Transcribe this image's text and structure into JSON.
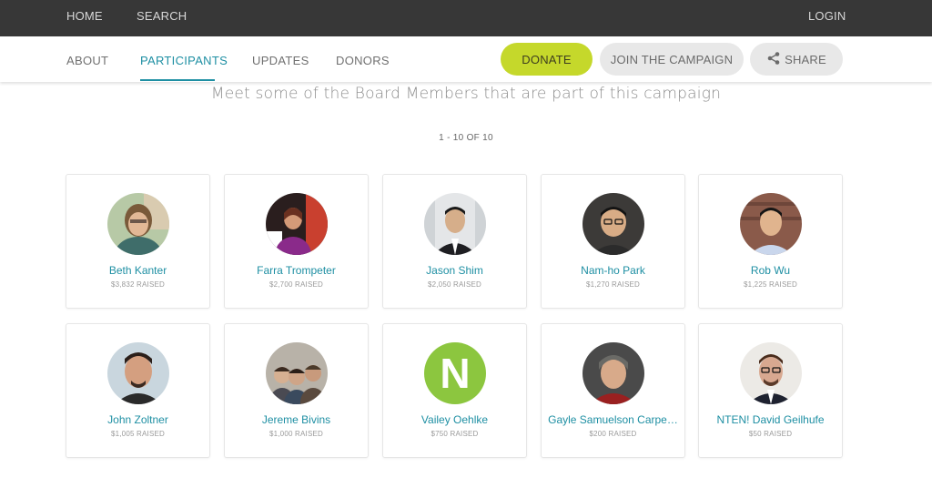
{
  "topnav": {
    "home": "HOME",
    "search": "SEARCH",
    "login": "LOGIN"
  },
  "tabs": {
    "about": "ABOUT",
    "participants": "PARTICIPANTS",
    "updates": "UPDATES",
    "donors": "DONORS"
  },
  "actions": {
    "donate": "DONATE",
    "join": "JOIN THE CAMPAIGN",
    "share": "SHARE"
  },
  "intro": "Meet some of the Board Members that are part of this campaign",
  "pagination": "1 - 10 OF 10",
  "participants": [
    {
      "name": "Beth Kanter",
      "raised": "$3,832 RAISED"
    },
    {
      "name": "Farra Trompeter",
      "raised": "$2,700 RAISED"
    },
    {
      "name": "Jason Shim",
      "raised": "$2,050 RAISED"
    },
    {
      "name": "Nam-ho Park",
      "raised": "$1,270 RAISED"
    },
    {
      "name": "Rob Wu",
      "raised": "$1,225 RAISED"
    },
    {
      "name": "John Zoltner",
      "raised": "$1,005 RAISED"
    },
    {
      "name": "Jereme Bivins",
      "raised": "$1,000 RAISED"
    },
    {
      "name": "Vailey Oehlke",
      "raised": "$750 RAISED"
    },
    {
      "name": "Gayle Samuelson Carpe…",
      "raised": "$200 RAISED"
    },
    {
      "name": "NTEN! David Geilhufe",
      "raised": "$50 RAISED"
    }
  ],
  "avatar_letter": "N",
  "colors": {
    "accent": "#1e8fa3",
    "donate": "#c5d82b",
    "topbar": "#373737"
  }
}
